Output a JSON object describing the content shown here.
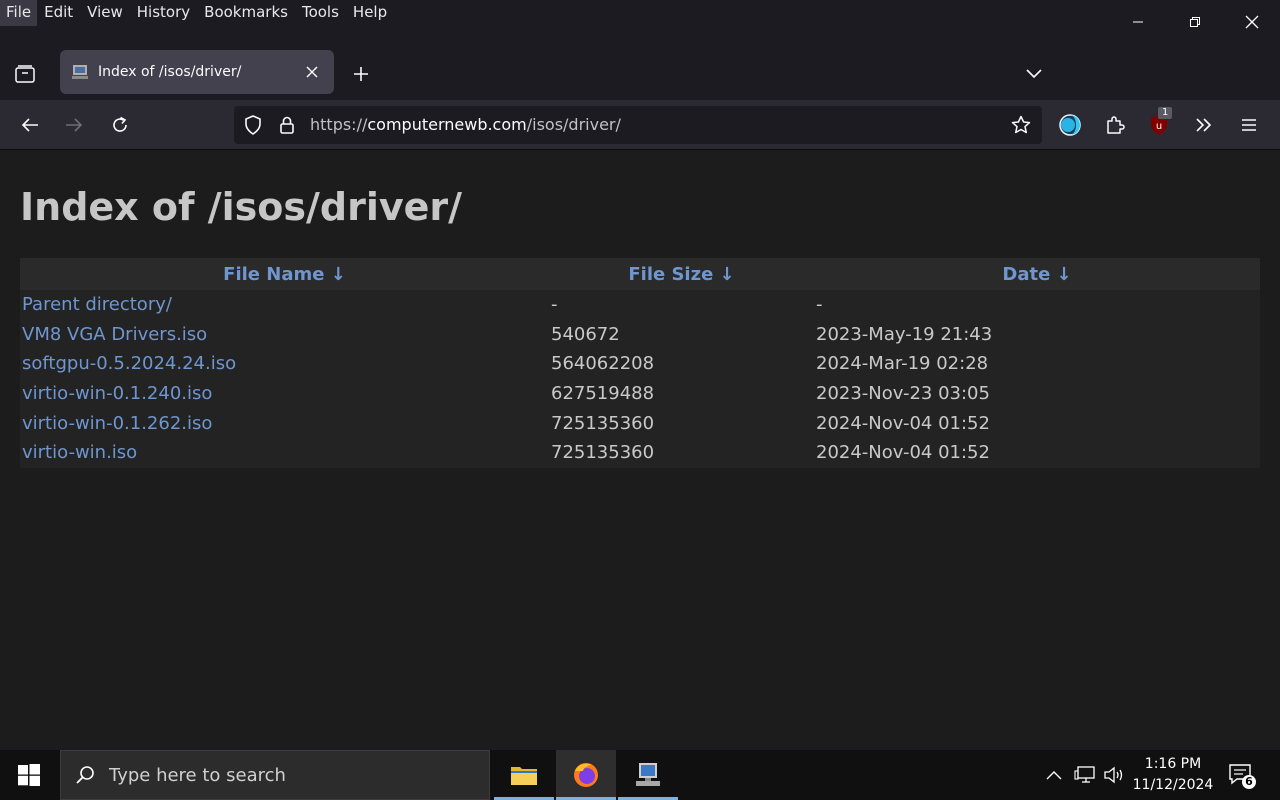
{
  "menubar": {
    "items": [
      "File",
      "Edit",
      "View",
      "History",
      "Bookmarks",
      "Tools",
      "Help"
    ]
  },
  "tab": {
    "title": "Index of /isos/driver/"
  },
  "urlbar": {
    "scheme": "https://",
    "host": "computernewb.com",
    "path": "/isos/driver/"
  },
  "toolbar": {
    "extension_badge": "1"
  },
  "page": {
    "heading": "Index of /isos/driver/",
    "columns": {
      "name": "File Name  ↓",
      "size": "File Size  ↓",
      "date": "Date  ↓"
    },
    "rows": [
      {
        "name": "Parent directory/",
        "size": "-",
        "date": "-"
      },
      {
        "name": "VM8 VGA Drivers.iso",
        "size": "540672",
        "date": "2023-May-19 21:43"
      },
      {
        "name": "softgpu-0.5.2024.24.iso",
        "size": "564062208",
        "date": "2024-Mar-19 02:28"
      },
      {
        "name": "virtio-win-0.1.240.iso",
        "size": "627519488",
        "date": "2023-Nov-23 03:05"
      },
      {
        "name": "virtio-win-0.1.262.iso",
        "size": "725135360",
        "date": "2024-Nov-04 01:52"
      },
      {
        "name": "virtio-win.iso",
        "size": "725135360",
        "date": "2024-Nov-04 01:52"
      }
    ]
  },
  "taskbar": {
    "search_placeholder": "Type here to search",
    "time": "1:16 PM",
    "date": "11/12/2024",
    "notification_count": "6"
  },
  "colors": {
    "link": "#6f96cf",
    "accent": "#7ab2e8"
  }
}
